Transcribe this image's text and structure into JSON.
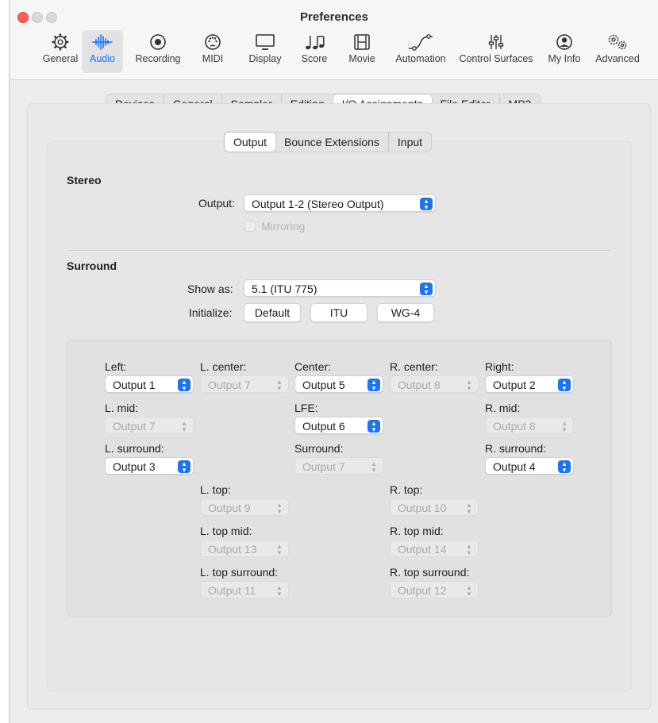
{
  "window": {
    "title": "Preferences"
  },
  "toolbar": [
    {
      "label": "General",
      "icon": "gear-icon"
    },
    {
      "label": "Audio",
      "icon": "waveform-icon",
      "selected": true
    },
    {
      "label": "Recording",
      "icon": "record-icon"
    },
    {
      "label": "MIDI",
      "icon": "midi-connector-icon"
    },
    {
      "label": "Display",
      "icon": "monitor-icon"
    },
    {
      "label": "Score",
      "icon": "music-notes-icon"
    },
    {
      "label": "Movie",
      "icon": "film-icon"
    },
    {
      "label": "Automation",
      "icon": "automation-curve-icon"
    },
    {
      "label": "Control Surfaces",
      "icon": "sliders-icon"
    },
    {
      "label": "My Info",
      "icon": "person-icon"
    },
    {
      "label": "Advanced",
      "icon": "gears-icon"
    }
  ],
  "tabs": [
    "Devices",
    "General",
    "Sampler",
    "Editing",
    "I/O Assignments",
    "File Editor",
    "MP3"
  ],
  "selected_tab": "I/O Assignments",
  "subtabs": [
    "Output",
    "Bounce Extensions",
    "Input"
  ],
  "selected_subtab": "Output",
  "stereo": {
    "title": "Stereo",
    "output_label": "Output:",
    "output_value": "Output 1-2 (Stereo Output)",
    "mirroring_label": "Mirroring",
    "mirroring_checked": false,
    "mirroring_enabled": false
  },
  "surround": {
    "title": "Surround",
    "show_as_label": "Show as:",
    "show_as_value": "5.1 (ITU 775)",
    "initialize_label": "Initialize:",
    "buttons": [
      "Default",
      "ITU",
      "WG-4"
    ],
    "channels": {
      "left": {
        "label": "Left:",
        "value": "Output 1",
        "enabled": true
      },
      "l_center": {
        "label": "L. center:",
        "value": "Output 7",
        "enabled": false
      },
      "center": {
        "label": "Center:",
        "value": "Output 5",
        "enabled": true
      },
      "r_center": {
        "label": "R. center:",
        "value": "Output 8",
        "enabled": false
      },
      "right": {
        "label": "Right:",
        "value": "Output 2",
        "enabled": true
      },
      "l_mid": {
        "label": "L. mid:",
        "value": "Output 7",
        "enabled": false
      },
      "lfe": {
        "label": "LFE:",
        "value": "Output 6",
        "enabled": true
      },
      "r_mid": {
        "label": "R. mid:",
        "value": "Output 8",
        "enabled": false
      },
      "l_surround": {
        "label": "L. surround:",
        "value": "Output 3",
        "enabled": true
      },
      "surround": {
        "label": "Surround:",
        "value": "Output 7",
        "enabled": false
      },
      "r_surround": {
        "label": "R. surround:",
        "value": "Output 4",
        "enabled": true
      },
      "l_top": {
        "label": "L. top:",
        "value": "Output 9",
        "enabled": false
      },
      "r_top": {
        "label": "R. top:",
        "value": "Output 10",
        "enabled": false
      },
      "l_top_mid": {
        "label": "L. top mid:",
        "value": "Output 13",
        "enabled": false
      },
      "r_top_mid": {
        "label": "R. top mid:",
        "value": "Output 14",
        "enabled": false
      },
      "l_top_surround": {
        "label": "L. top surround:",
        "value": "Output 11",
        "enabled": false
      },
      "r_top_surround": {
        "label": "R. top surround:",
        "value": "Output 12",
        "enabled": false
      }
    }
  },
  "colors": {
    "accent": "#1e73f0",
    "close": "#ff5f57"
  }
}
